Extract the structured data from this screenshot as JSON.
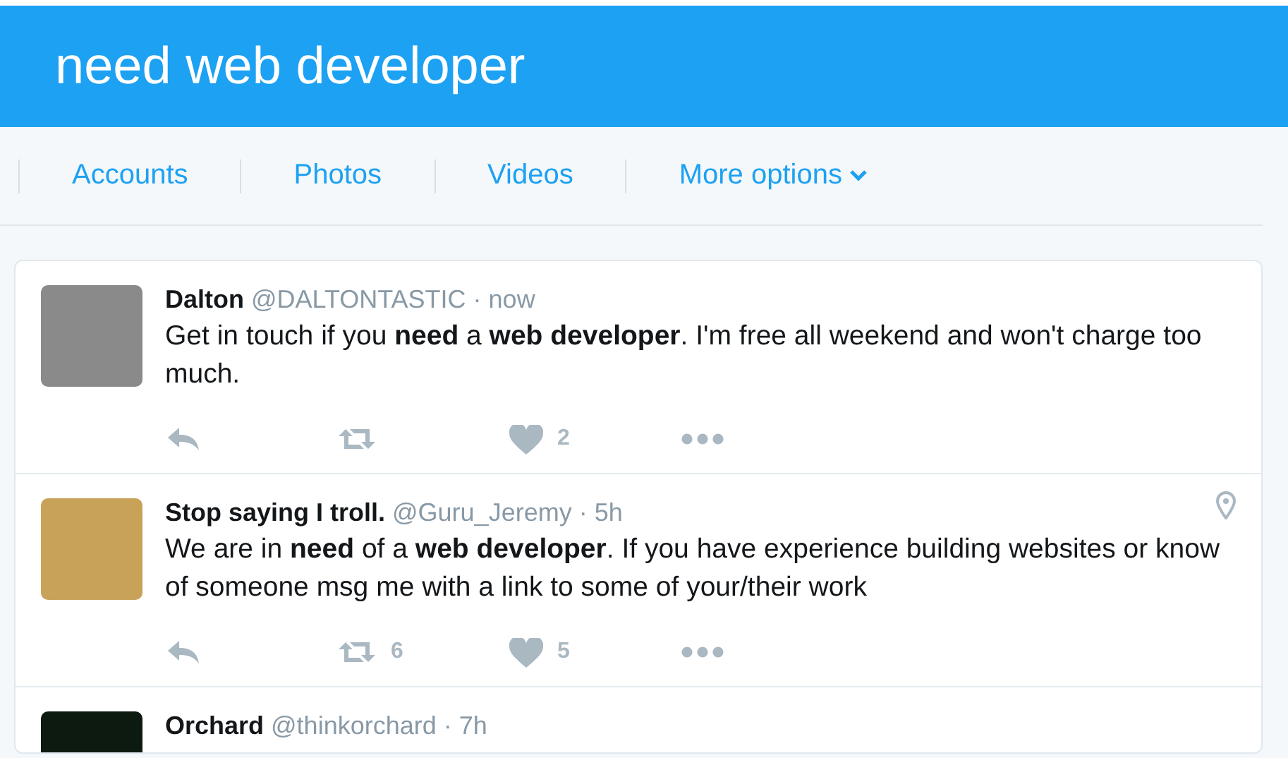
{
  "header": {
    "title": "need web developer"
  },
  "nav": {
    "items": [
      {
        "label": "Accounts",
        "dropdown": false
      },
      {
        "label": "Photos",
        "dropdown": false
      },
      {
        "label": "Videos",
        "dropdown": false
      },
      {
        "label": "More options",
        "dropdown": true
      }
    ]
  },
  "tweets": [
    {
      "name": "Dalton",
      "handle": "@DALTONTASTIC",
      "dot": "·",
      "time": "now",
      "text": "Get in touch if you **need** a **web developer**. I'm free all weekend and won't charge too much.",
      "location": false,
      "likes": "2"
    },
    {
      "name": "Stop saying I troll.",
      "handle": "@Guru_Jeremy",
      "dot": "·",
      "time": "5h",
      "text": "We are in **need** of a **web developer**. If you have experience building websites or know of someone msg me with a link to some of your/their work",
      "location": true,
      "retweets": "6",
      "likes": "5"
    },
    {
      "name": "Orchard",
      "handle": "@thinkorchard",
      "dot": "·",
      "time": "7h",
      "location": false
    }
  ]
}
